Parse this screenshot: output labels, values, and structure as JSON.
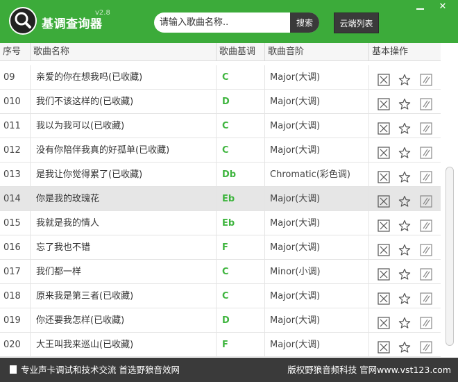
{
  "app": {
    "title": "基调查询器",
    "version": "v2.8"
  },
  "search": {
    "placeholder": "请输入歌曲名称..",
    "button_label": "搜索"
  },
  "toolbar": {
    "cloud_list_label": "云端列表"
  },
  "window": {
    "close_glyph": "✕"
  },
  "table": {
    "headers": {
      "no": "序号",
      "name": "歌曲名称",
      "key": "歌曲基调",
      "scale": "歌曲音阶",
      "ops": "基本操作"
    },
    "rows": [
      {
        "no": "09",
        "name": "亲爱的你在想我吗(已收藏)",
        "key": "C",
        "scale": "Major(大调)",
        "selected": false
      },
      {
        "no": "010",
        "name": "我们不该这样的(已收藏)",
        "key": "D",
        "scale": "Major(大调)",
        "selected": false
      },
      {
        "no": "011",
        "name": "我以为我可以(已收藏)",
        "key": "C",
        "scale": "Major(大调)",
        "selected": false
      },
      {
        "no": "012",
        "name": "没有你陪伴我真的好孤单(已收藏)",
        "key": "C",
        "scale": "Major(大调)",
        "selected": false
      },
      {
        "no": "013",
        "name": "是我让你觉得累了(已收藏)",
        "key": "Db",
        "scale": "Chromatic(彩色调)",
        "selected": false
      },
      {
        "no": "014",
        "name": "你是我的玫瑰花",
        "key": "Eb",
        "scale": "Major(大调)",
        "selected": true
      },
      {
        "no": "015",
        "name": "我就是我的情人",
        "key": "Eb",
        "scale": "Major(大调)",
        "selected": false
      },
      {
        "no": "016",
        "name": "忘了我也不错",
        "key": "F",
        "scale": "Major(大调)",
        "selected": false
      },
      {
        "no": "017",
        "name": "我们都一样",
        "key": "C",
        "scale": "Minor(小调)",
        "selected": false
      },
      {
        "no": "018",
        "name": "原来我是第三者(已收藏)",
        "key": "C",
        "scale": "Major(大调)",
        "selected": false
      },
      {
        "no": "019",
        "name": "你还要我怎样(已收藏)",
        "key": "D",
        "scale": "Major(大调)",
        "selected": false
      },
      {
        "no": "020",
        "name": "大王叫我来巡山(已收藏)",
        "key": "F",
        "scale": "Major(大调)",
        "selected": false
      }
    ]
  },
  "status": {
    "left_text": "专业声卡调试和技术交流 首选野狼音效网",
    "right_text": "版权野狼音频科技 官网www.vst123.com"
  },
  "colors": {
    "brand_green": "#3cab3a",
    "dark": "#3a3a3a",
    "key_green": "#3fb53f"
  }
}
